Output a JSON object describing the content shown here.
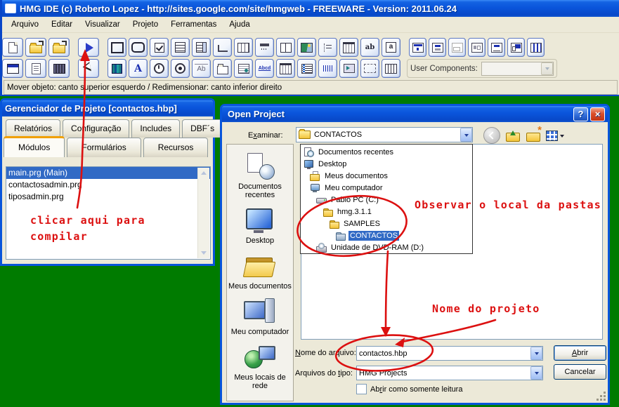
{
  "colors": {
    "desktop_green": "#007B00",
    "titlebar_blue": "#0A55DB",
    "selection_blue": "#316AC5",
    "annotation_red": "#DC1010",
    "tab_accent_orange": "#F0A000"
  },
  "window": {
    "title": "HMG IDE (c) Roberto Lopez - http://sites.google.com/site/hmgweb - FREEWARE - Version: 2011.06.24"
  },
  "menubar": {
    "items": [
      "Arquivo",
      "Editar",
      "Visualizar",
      "Projeto",
      "Ferramentas",
      "Ajuda"
    ]
  },
  "toolbar": {
    "user_components_label": "User Components:",
    "row1_groups": [
      [
        {
          "name": "new-project",
          "icon": "paper"
        },
        {
          "name": "open-project",
          "icon": "folder-open"
        },
        {
          "name": "save-as-project",
          "icon": "folder-out"
        }
      ],
      [
        {
          "name": "run-project",
          "icon": "play"
        }
      ],
      [
        {
          "name": "form-tool",
          "icon": "window-plain"
        },
        {
          "name": "rounded-form-tool",
          "icon": "window-round"
        },
        {
          "name": "checkbox-tool",
          "icon": "check"
        },
        {
          "name": "listbox-tool",
          "icon": "lines"
        },
        {
          "name": "combobox-tool",
          "icon": "combo"
        },
        {
          "name": "line-tool",
          "icon": "angle"
        },
        {
          "name": "grid-tool",
          "icon": "grid"
        },
        {
          "name": "toolbar-tool",
          "icon": "hammer"
        },
        {
          "name": "splitbox-tool",
          "icon": "split"
        },
        {
          "name": "image-tool",
          "icon": "image"
        },
        {
          "name": "tree-tool",
          "icon": "tree"
        },
        {
          "name": "datepicker-tool",
          "icon": "calendar"
        },
        {
          "name": "textbox-tool",
          "icon": "ab",
          "text": "ab"
        },
        {
          "name": "page-tool",
          "icon": "page-a",
          "text": "a"
        }
      ],
      [
        {
          "name": "dock-top-tool",
          "icon": "dock1"
        },
        {
          "name": "dock-stack-tool",
          "icon": "dock2"
        },
        {
          "name": "dock-bottom-tool",
          "icon": "dock3"
        },
        {
          "name": "dock-center-tool",
          "icon": "dock4"
        },
        {
          "name": "dock-list-tool",
          "icon": "dock5"
        },
        {
          "name": "dock-tabbed-tool",
          "icon": "dock6"
        },
        {
          "name": "dock-columns-tool",
          "icon": "dock7"
        }
      ]
    ],
    "row2_groups": [
      [
        {
          "name": "window-form-tool",
          "icon": "window-titled"
        },
        {
          "name": "report-tool",
          "icon": "doc-lines"
        },
        {
          "name": "dark-grid-tool",
          "icon": "grid-dark"
        }
      ],
      [
        {
          "name": "pointer-tool",
          "icon": "pointer"
        }
      ],
      [
        {
          "name": "library-tool",
          "icon": "books"
        },
        {
          "name": "label-tool",
          "icon": "A",
          "text": "A"
        },
        {
          "name": "timer-tool",
          "icon": "clock"
        },
        {
          "name": "radio-tool",
          "icon": "radio"
        },
        {
          "name": "frame-tool",
          "icon": "frame-ab",
          "text": "Ab"
        },
        {
          "name": "tab-control-tool",
          "icon": "tab"
        },
        {
          "name": "slides-tool",
          "icon": "film"
        },
        {
          "name": "hyperlink-tool",
          "icon": "link",
          "text": "Abcd"
        },
        {
          "name": "monthcal-tool",
          "icon": "calendar"
        },
        {
          "name": "checklist-tool",
          "icon": "checklist"
        },
        {
          "name": "barcode-tool",
          "icon": "barcode"
        },
        {
          "name": "player-tool",
          "icon": "player"
        },
        {
          "name": "dotted-frame-tool",
          "icon": "dotted"
        },
        {
          "name": "data-grid-tool",
          "icon": "dbgrid"
        }
      ]
    ]
  },
  "statusbar": {
    "text": "Mover objeto: canto superior esquerdo / Redimensionar: canto inferior direito"
  },
  "project_manager": {
    "title": "Gerenciador de Projeto [contactos.hbp]",
    "tabs_row1": [
      "Relatórios",
      "Configuração",
      "Includes",
      "DBF´s"
    ],
    "tabs_row2": [
      "Módulos",
      "Formulários",
      "Recursos"
    ],
    "active_tab": "Módulos",
    "modules": [
      "main.prg (Main)",
      "contactosadmin.prg",
      "tiposadmin.prg"
    ],
    "selected_module": "main.prg (Main)"
  },
  "open_dialog": {
    "title": "Open Project",
    "help_glyph": "?",
    "close_glyph": "×",
    "examinar_label": {
      "text": "Examinar:",
      "u": 1
    },
    "examinar_value": "CONTACTOS",
    "places": [
      {
        "label": "Documentos recentes",
        "icon": "recent"
      },
      {
        "label": "Desktop",
        "icon": "desktop"
      },
      {
        "label": "Meus documentos",
        "icon": "docs"
      },
      {
        "label": "Meu computador",
        "icon": "computer"
      },
      {
        "label": "Meus locais de rede",
        "icon": "network"
      }
    ],
    "tree": [
      {
        "label": "Documentos recentes",
        "icon": "recent",
        "indent": 0
      },
      {
        "label": "Desktop",
        "icon": "desktop",
        "indent": 0
      },
      {
        "label": "Meus documentos",
        "icon": "docs",
        "indent": 1
      },
      {
        "label": "Meu computador",
        "icon": "computer",
        "indent": 1
      },
      {
        "label": "Pablo PC (C:)",
        "icon": "hdd",
        "indent": 2
      },
      {
        "label": "hmg.3.1.1",
        "icon": "folder",
        "indent": 3
      },
      {
        "label": "SAMPLES",
        "icon": "folder",
        "indent": 4
      },
      {
        "label": "CONTACTOS",
        "icon": "folder-open",
        "indent": 5,
        "selected": true
      },
      {
        "label": "Unidade de DVD-RAM (D:)",
        "icon": "dvd",
        "indent": 2
      }
    ],
    "file_name_label": {
      "text": "Nome do arquivo:",
      "u": 0
    },
    "file_name_value": "contactos.hbp",
    "file_type_label": {
      "text": "Arquivos do tipo:",
      "u": 12
    },
    "file_type_value": "HMG Projects",
    "readonly_label": {
      "text": "Abrir como somente leitura",
      "u": 2
    },
    "open_button": {
      "text": "Abrir",
      "u": 0
    },
    "cancel_button": "Cancelar"
  },
  "annotations": {
    "compile_note": "clicar aqui para\ncompilar",
    "folder_note": "Observar o local da pastas",
    "project_name_note": "Nome do projeto"
  }
}
